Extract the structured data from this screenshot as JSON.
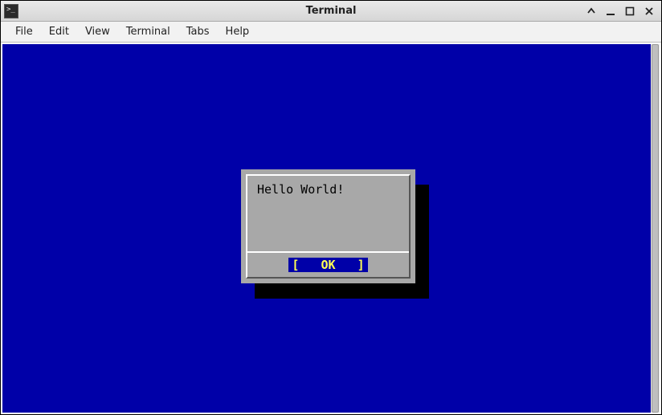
{
  "window": {
    "title": "Terminal"
  },
  "menubar": {
    "items": [
      "File",
      "Edit",
      "View",
      "Terminal",
      "Tabs",
      "Help"
    ]
  },
  "dialog": {
    "message": "Hello World!",
    "button_label": "[   OK   ]"
  },
  "colors": {
    "terminal_bg": "#0000a8",
    "dialog_bg": "#a8a8a8",
    "button_bg": "#0000a8",
    "button_fg": "#ffff55"
  }
}
